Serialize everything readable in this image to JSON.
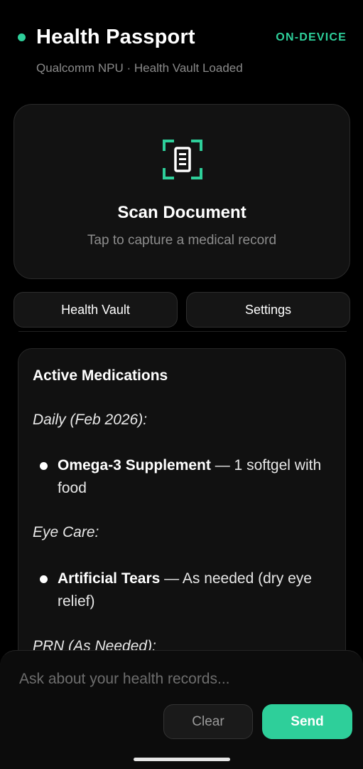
{
  "header": {
    "title": "Health Passport",
    "badge": "ON-DEVICE",
    "subtitle": "Qualcomm NPU · Health Vault Loaded",
    "status_color": "#2ecf9a"
  },
  "scan_card": {
    "icon": "document-scan-icon",
    "title": "Scan Document",
    "subtitle": "Tap to capture a medical record"
  },
  "actions": {
    "vault_label": "Health Vault",
    "settings_label": "Settings"
  },
  "medications": {
    "title": "Active Medications",
    "sections": [
      {
        "label": "Daily (Feb 2026):",
        "items": [
          {
            "name": "Omega-3 Supplement",
            "detail": " — 1 softgel with food"
          }
        ]
      },
      {
        "label": "Eye Care:",
        "items": [
          {
            "name": "Artificial Tears",
            "detail": " — As needed (dry eye relief)"
          }
        ]
      },
      {
        "label": "PRN (As Needed):",
        "items": []
      }
    ]
  },
  "composer": {
    "placeholder": "Ask about your health records...",
    "clear_label": "Clear",
    "send_label": "Send"
  },
  "colors": {
    "accent": "#2ecf9a",
    "background": "#000000",
    "card": "#121212"
  }
}
